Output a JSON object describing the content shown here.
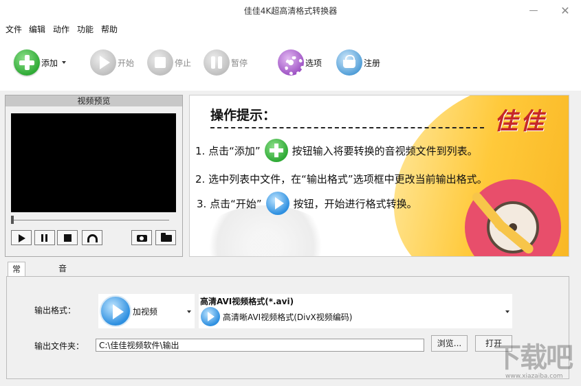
{
  "window": {
    "title": "佳佳4K超高清格式转换器",
    "minimize": "—",
    "close": "✕"
  },
  "menu": {
    "items": [
      "文件",
      "编辑",
      "动作",
      "功能",
      "帮助"
    ]
  },
  "toolbar": {
    "add": {
      "label": "添加",
      "icon": "add-icon"
    },
    "start": {
      "label": "开始",
      "icon": "play-icon",
      "disabled": true
    },
    "stop": {
      "label": "停止",
      "icon": "stop-icon",
      "disabled": true
    },
    "pause": {
      "label": "暂停",
      "icon": "pause-icon",
      "disabled": true
    },
    "options": {
      "label": "选项",
      "icon": "gear-icon"
    },
    "register": {
      "label": "注册",
      "icon": "basket-icon"
    }
  },
  "preview": {
    "title": "视频预览"
  },
  "banner": {
    "heading": "操作提示：",
    "logo": "佳佳",
    "step1_pre": "1. 点击“添加”",
    "step1_post": "按钮输入将要转换的音视频文件到列表。",
    "step2": "2. 选中列表中文件，在“输出格式”选项框中更改当前输出格式。",
    "step3_pre": "3. 点击“开始”",
    "step3_post": "按钮，开始进行格式转换。"
  },
  "tabs": {
    "general": "常规设置",
    "advanced": "音视频高级设置"
  },
  "settings": {
    "output_format_label": "输出格式：",
    "category": "加视频",
    "format_title": "高清AVI视频格式(*.avi)",
    "format_detail": "高清晰AVI视频格式(DivX视频编码)",
    "output_folder_label": "输出文件夹：",
    "output_folder_value": "C:\\佳佳视频软件\\输出",
    "browse_button": "浏览...",
    "open_button": "打开"
  },
  "watermark": {
    "text": "下载吧",
    "url": "www.xiazaiba.com"
  }
}
